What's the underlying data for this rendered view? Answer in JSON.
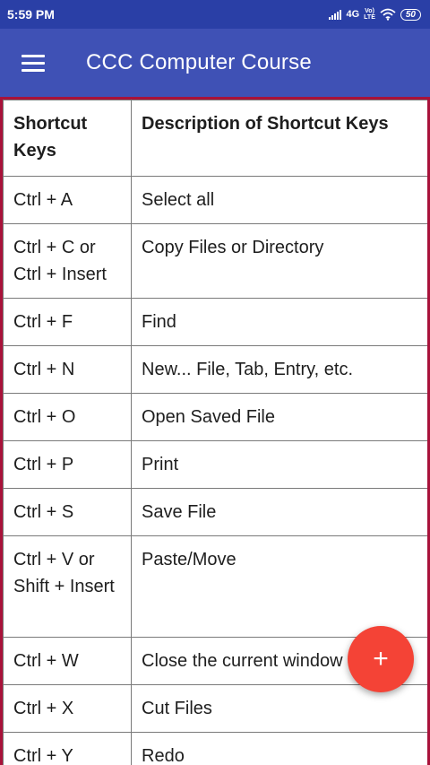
{
  "status_bar": {
    "time": "5:59 PM",
    "network": "4G",
    "volte_line1": "Vo)",
    "volte_line2": "LTE",
    "battery": "50"
  },
  "app_bar": {
    "title": "CCC Computer Course",
    "menu_icon": "hamburger-menu-icon"
  },
  "table": {
    "headers": [
      "Shortcut Keys",
      "Description of Shortcut Keys"
    ],
    "rows": [
      {
        "keys": "Ctrl + A",
        "description": "Select all"
      },
      {
        "keys": "Ctrl + C or Ctrl + Insert",
        "description": "Copy Files or Directory"
      },
      {
        "keys": "Ctrl + F",
        "description": "Find"
      },
      {
        "keys": "Ctrl + N",
        "description": "New... File, Tab, Entry, etc."
      },
      {
        "keys": "Ctrl + O",
        "description": "Open Saved File"
      },
      {
        "keys": "Ctrl + P",
        "description": "Print"
      },
      {
        "keys": "Ctrl + S",
        "description": "Save File"
      },
      {
        "keys": "Ctrl + V or Shift + Insert",
        "description": "Paste/Move"
      },
      {
        "keys": "Ctrl + W",
        "description": "Close the current window"
      },
      {
        "keys": "Ctrl + X",
        "description": "Cut Files"
      },
      {
        "keys": "Ctrl + Y",
        "description": "Redo"
      }
    ]
  },
  "fab": {
    "label": "+",
    "icon": "plus-icon",
    "color": "#f44336"
  },
  "colors": {
    "status_bar": "#2a3fa6",
    "app_bar": "#3f51b5",
    "content_border": "#a8123a"
  }
}
